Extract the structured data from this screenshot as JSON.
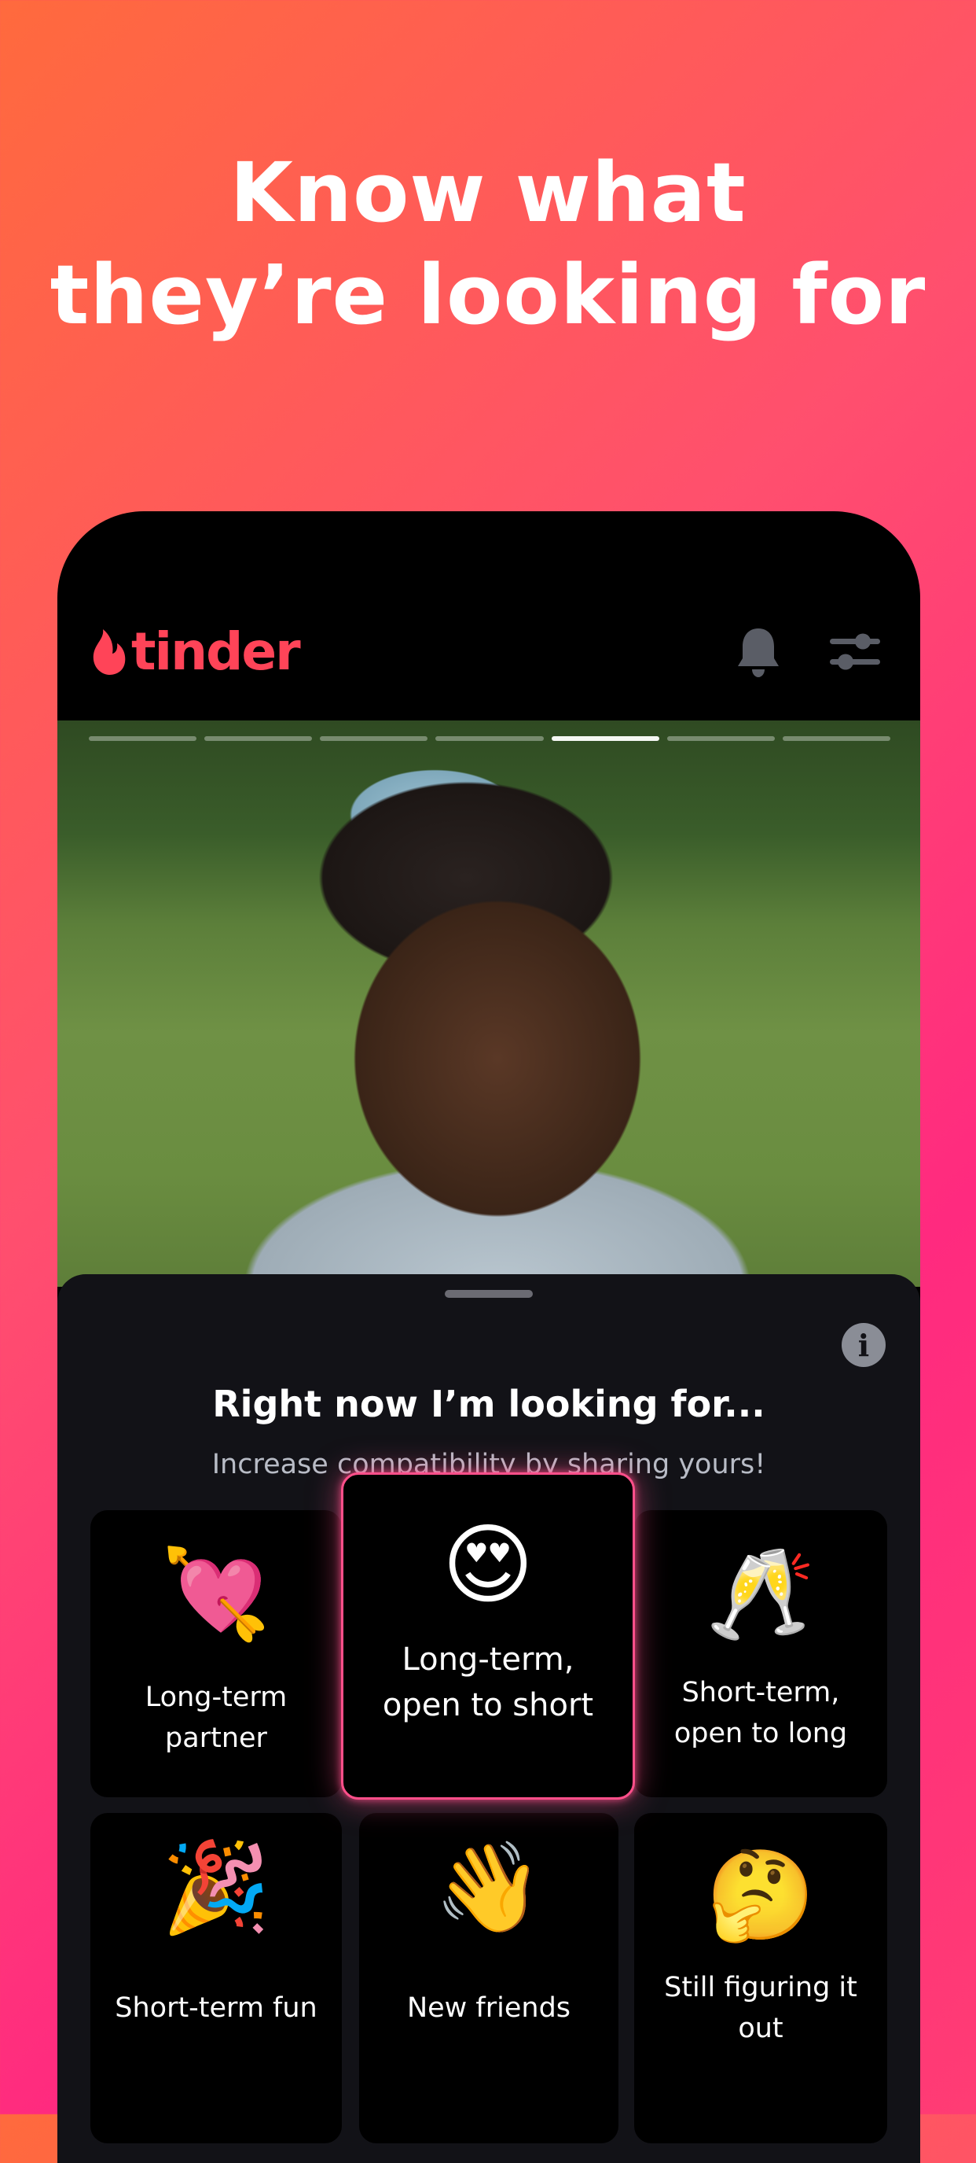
{
  "headline": {
    "line1": "Know what",
    "line2": "they’re looking for"
  },
  "app": {
    "logo_text": "tinder"
  },
  "photo": {
    "segments": 7,
    "active_segment": 5
  },
  "sheet": {
    "title": "Right now I’m looking for...",
    "subtitle": "Increase compatibility by sharing yours!",
    "info_label": "i"
  },
  "options": [
    {
      "emoji": "💘",
      "label": "Long-term partner",
      "selected": false
    },
    {
      "emoji": "😍",
      "label": "Long-term, open to short",
      "selected": true
    },
    {
      "emoji": "🥂",
      "label": "Short-term, open to long",
      "selected": false
    },
    {
      "emoji": "🎉",
      "label": "Short-term fun",
      "selected": false
    },
    {
      "emoji": "👋",
      "label": "New friends",
      "selected": false
    },
    {
      "emoji": "🤔",
      "label": "Still figuring it out",
      "selected": false
    }
  ],
  "colors": {
    "brand": "#ff4458",
    "selected_border": "#ff4f8a"
  }
}
